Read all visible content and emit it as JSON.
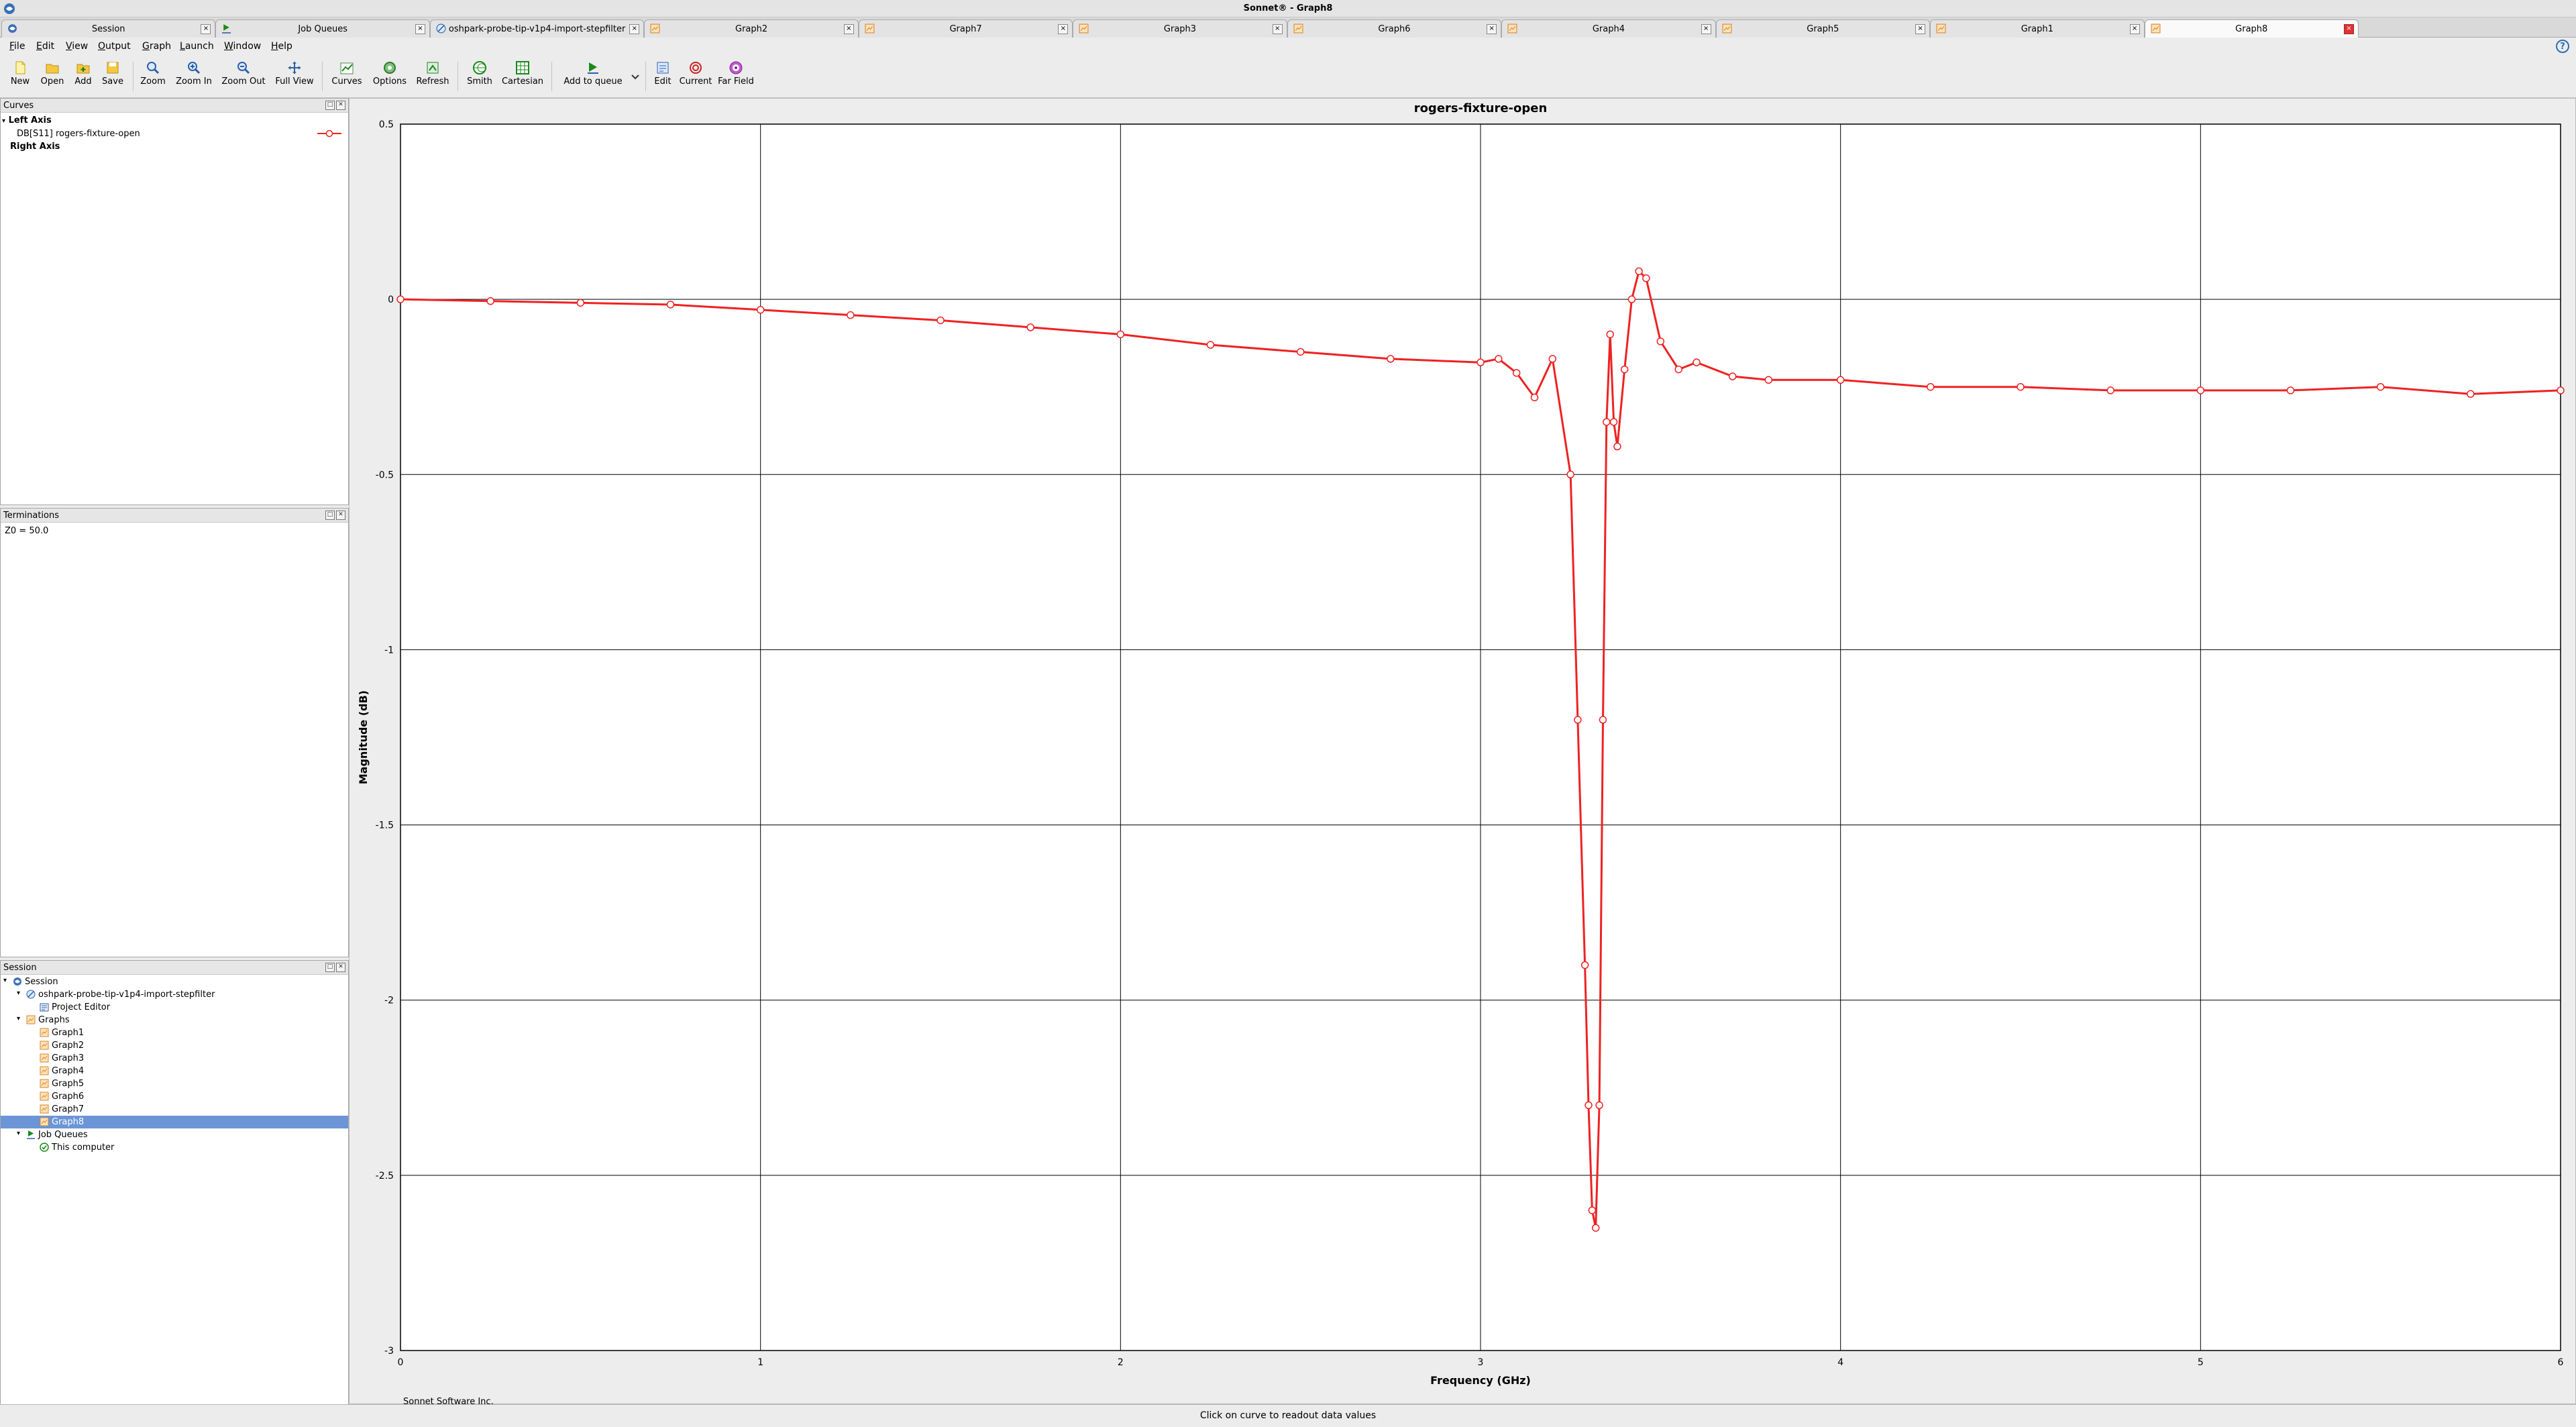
{
  "window": {
    "title": "Sonnet® - Graph8"
  },
  "tabs": [
    {
      "label": "Session",
      "icon": "session-icon",
      "active": false
    },
    {
      "label": "Job Queues",
      "icon": "job-queue-icon",
      "active": false
    },
    {
      "label": "oshpark-probe-tip-v1p4-import-stepfilter",
      "icon": "project-icon",
      "active": false
    },
    {
      "label": "Graph2",
      "icon": "graph-icon",
      "active": false
    },
    {
      "label": "Graph7",
      "icon": "graph-icon",
      "active": false
    },
    {
      "label": "Graph3",
      "icon": "graph-icon",
      "active": false
    },
    {
      "label": "Graph6",
      "icon": "graph-icon",
      "active": false
    },
    {
      "label": "Graph4",
      "icon": "graph-icon",
      "active": false
    },
    {
      "label": "Graph5",
      "icon": "graph-icon",
      "active": false
    },
    {
      "label": "Graph1",
      "icon": "graph-icon",
      "active": false
    },
    {
      "label": "Graph8",
      "icon": "graph-icon",
      "active": true
    }
  ],
  "menu": [
    {
      "label": "File",
      "ul": "F",
      "rest": "ile"
    },
    {
      "label": "Edit",
      "ul": "E",
      "rest": "dit"
    },
    {
      "label": "View",
      "ul": "V",
      "rest": "iew"
    },
    {
      "label": "Output",
      "ul": "O",
      "rest": "utput"
    },
    {
      "label": "Graph",
      "ul": "G",
      "rest": "raph"
    },
    {
      "label": "Launch",
      "ul": "L",
      "rest": "aunch"
    },
    {
      "label": "Window",
      "ul": "W",
      "rest": "indow"
    },
    {
      "label": "Help",
      "ul": "H",
      "rest": "elp"
    }
  ],
  "toolbar": {
    "new": "New",
    "open": "Open",
    "add": "Add",
    "save": "Save",
    "zoom": "Zoom",
    "zoom_in": "Zoom In",
    "zoom_out": "Zoom Out",
    "full_view": "Full View",
    "curves": "Curves",
    "options": "Options",
    "refresh": "Refresh",
    "smith": "Smith",
    "cartesian": "Cartesian",
    "add_to_queue": "Add to queue",
    "edit": "Edit",
    "current": "Current",
    "far_field": "Far Field"
  },
  "curves_panel": {
    "title": "Curves",
    "left_axis": "Left Axis",
    "curve_name": "DB[S11] rogers-fixture-open",
    "right_axis": "Right Axis"
  },
  "terminations_panel": {
    "title": "Terminations",
    "z0": "Z0 = 50.0"
  },
  "session_panel": {
    "title": "Session",
    "items": [
      {
        "label": "Session",
        "level": 0,
        "icon": "session-icon",
        "expanded": true
      },
      {
        "label": "oshpark-probe-tip-v1p4-import-stepfilter",
        "level": 1,
        "icon": "project-icon",
        "expanded": true
      },
      {
        "label": "Project Editor",
        "level": 2,
        "icon": "project-editor-icon"
      },
      {
        "label": "Graphs",
        "level": 1,
        "icon": "graphs-folder-icon",
        "expanded": true
      },
      {
        "label": "Graph1",
        "level": 2,
        "icon": "graph-icon"
      },
      {
        "label": "Graph2",
        "level": 2,
        "icon": "graph-icon"
      },
      {
        "label": "Graph3",
        "level": 2,
        "icon": "graph-icon"
      },
      {
        "label": "Graph4",
        "level": 2,
        "icon": "graph-icon"
      },
      {
        "label": "Graph5",
        "level": 2,
        "icon": "graph-icon"
      },
      {
        "label": "Graph6",
        "level": 2,
        "icon": "graph-icon"
      },
      {
        "label": "Graph7",
        "level": 2,
        "icon": "graph-icon"
      },
      {
        "label": "Graph8",
        "level": 2,
        "icon": "graph-icon",
        "selected": true
      },
      {
        "label": "Job Queues",
        "level": 1,
        "icon": "job-queue-icon",
        "expanded": true
      },
      {
        "label": "This computer",
        "level": 2,
        "icon": "computer-check-icon"
      }
    ]
  },
  "graph": {
    "footer": "Sonnet Software Inc.",
    "curve_color": "#ee2222"
  },
  "chart_data": {
    "type": "line",
    "title": "rogers-fixture-open",
    "xlabel": "Frequency (GHz)",
    "ylabel": "Magnitude (dB)",
    "xlim": [
      0,
      6
    ],
    "ylim": [
      -3,
      0.5
    ],
    "xticks": [
      "0",
      "1",
      "2",
      "3",
      "4",
      "5",
      "6"
    ],
    "yticks": [
      "0.5",
      "0",
      "-0.5",
      "-1",
      "-1.5",
      "-2",
      "-2.5",
      "-3"
    ],
    "grid": true,
    "marker": "circle",
    "series": [
      {
        "name": "DB[S11] rogers-fixture-open",
        "x": [
          0,
          0.25,
          0.5,
          0.75,
          1.0,
          1.25,
          1.5,
          1.75,
          2.0,
          2.25,
          2.5,
          2.75,
          3.0,
          3.05,
          3.1,
          3.15,
          3.2,
          3.25,
          3.27,
          3.29,
          3.3,
          3.31,
          3.32,
          3.33,
          3.34,
          3.35,
          3.36,
          3.37,
          3.38,
          3.4,
          3.42,
          3.44,
          3.46,
          3.5,
          3.55,
          3.6,
          3.7,
          3.8,
          4.0,
          4.25,
          4.5,
          4.75,
          5.0,
          5.25,
          5.5,
          5.75,
          6.0
        ],
        "y": [
          0.0,
          -0.005,
          -0.01,
          -0.015,
          -0.03,
          -0.045,
          -0.06,
          -0.08,
          -0.1,
          -0.13,
          -0.15,
          -0.17,
          -0.18,
          -0.17,
          -0.21,
          -0.28,
          -0.17,
          -0.5,
          -1.2,
          -1.9,
          -2.3,
          -2.6,
          -2.65,
          -2.3,
          -1.2,
          -0.35,
          -0.1,
          -0.35,
          -0.42,
          -0.2,
          -0.0,
          0.08,
          0.06,
          -0.12,
          -0.2,
          -0.18,
          -0.22,
          -0.23,
          -0.23,
          -0.25,
          -0.25,
          -0.26,
          -0.26,
          -0.26,
          -0.25,
          -0.27,
          -0.26
        ]
      }
    ]
  },
  "status": {
    "text": "Click on curve to readout data values"
  }
}
